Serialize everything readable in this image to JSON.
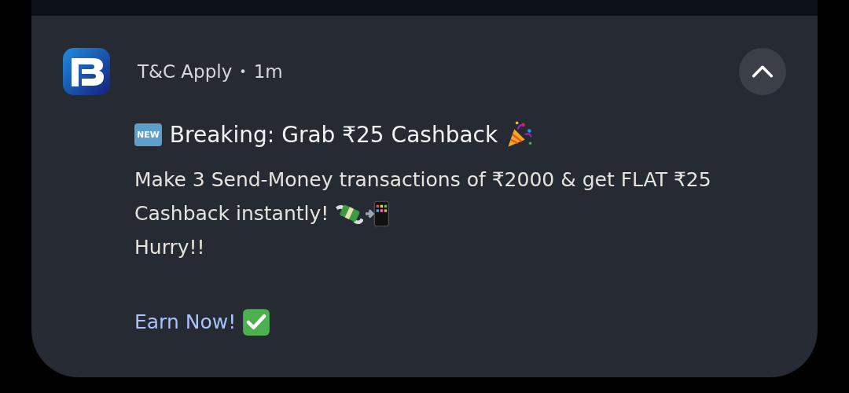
{
  "notification": {
    "app_label": "T&C Apply",
    "separator": "•",
    "time": "1m",
    "expanded": true,
    "title_badge": "NEW",
    "title": "Breaking: Grab ₹25 Cashback",
    "body_lines": [
      "Make 3 Send-Money transactions of ₹2000 & get FLAT ₹25",
      "Cashback instantly!",
      "Hurry!!"
    ],
    "action": "Earn Now!"
  }
}
